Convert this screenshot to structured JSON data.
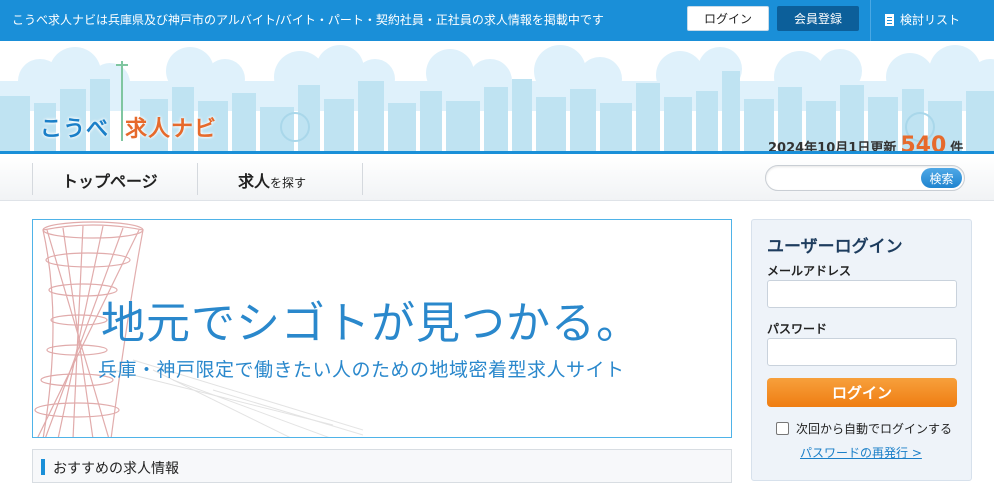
{
  "topbar": {
    "tagline": "こうべ求人ナビは兵庫県及び神戸市のアルバイト/バイト・パート・契約社員・正社員の求人情報を掲載中です",
    "login_label": "ログイン",
    "register_label": "会員登録",
    "checklist_label": "検討リスト",
    "checklist_icon": "document-icon"
  },
  "header": {
    "logo_part1": "こうべ",
    "logo_part2": "求人ナビ",
    "update_text": "2024年10月1日更新",
    "job_count": "540",
    "job_count_unit": "件"
  },
  "nav": {
    "items": [
      {
        "label": "トップページ"
      },
      {
        "label": "求人",
        "suffix": "を探す"
      }
    ],
    "search_placeholder": "",
    "search_button": "検索"
  },
  "hero": {
    "headline": "地元でシゴトが見つかる。",
    "subline": "兵庫・神戸限定で働きたい人のための地域密着型求人サイト"
  },
  "recommended": {
    "title": "おすすめの求人情報"
  },
  "login_panel": {
    "title": "ユーザーログイン",
    "email_label": "メールアドレス",
    "email_value": "",
    "password_label": "パスワード",
    "password_value": "",
    "login_button": "ログイン",
    "remember_label": "次回から自動でログインする",
    "reissue_link": "パスワードの再発行 >"
  },
  "colors": {
    "primary_blue": "#1a8fd8",
    "dark_blue": "#0c5f9a",
    "accent_orange": "#ef7d12",
    "count_orange": "#e66a2c"
  }
}
